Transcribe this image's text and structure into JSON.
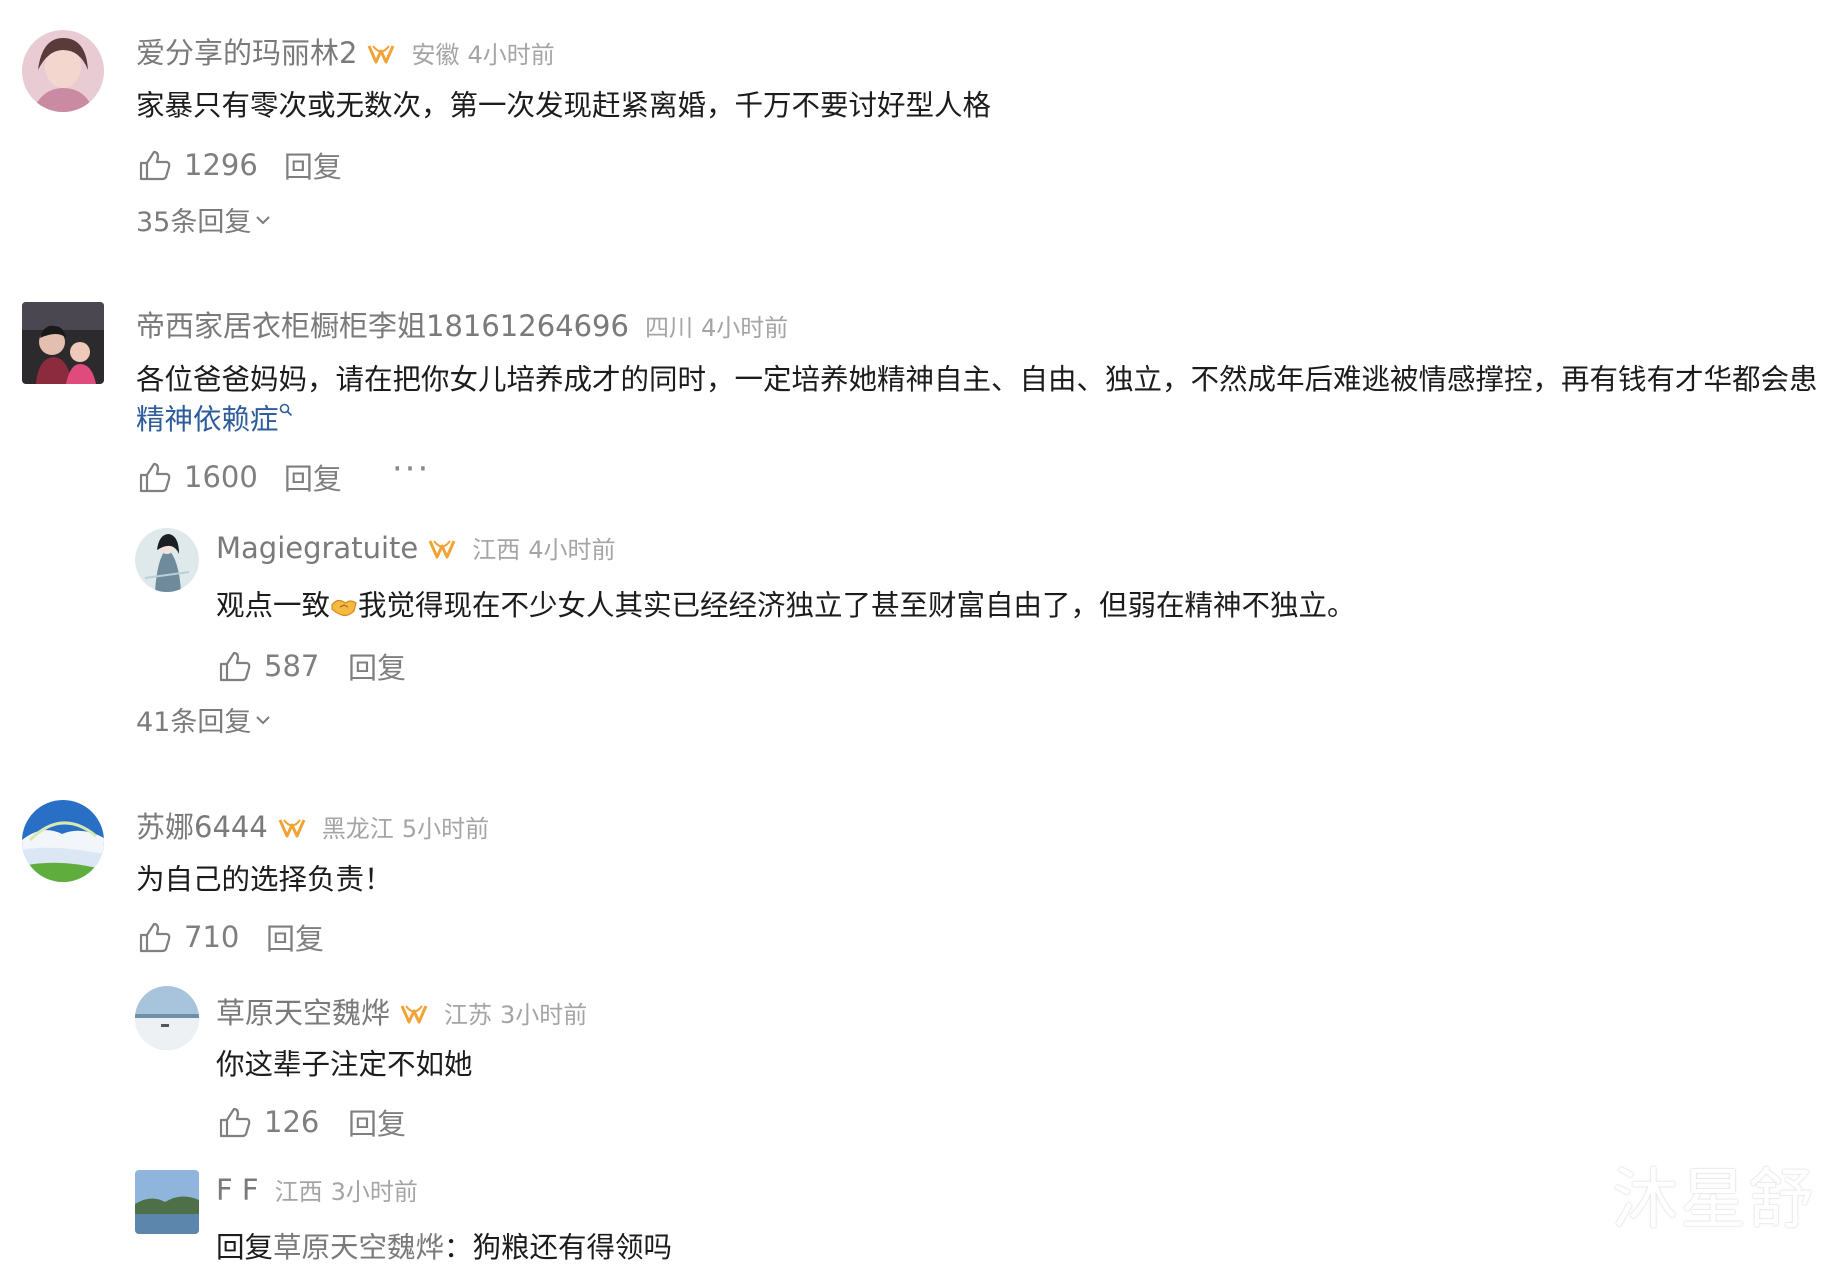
{
  "comments": [
    {
      "username": "爱分享的玛丽林2",
      "location": "安徽",
      "time": "4小时前",
      "text": "家暴只有零次或无数次，第一次发现赶紧离婚，千万不要讨好型人格",
      "likes": "1296",
      "reply_label": "回复",
      "more_replies": "35条回复"
    },
    {
      "username": "帝西家居衣柜橱柜李姐18161264696",
      "location": "四川",
      "time": "4小时前",
      "text": "各位爸爸妈妈，请在把你女儿培养成才的同时，一定培养她精神自主、自由、独立，不然成年后难逃被情感撑控，再有钱有才华都会患",
      "link_text": "精神依赖症",
      "likes": "1600",
      "reply_label": "回复",
      "more_label": "···",
      "sub_reply": {
        "username": "Magiegratuite",
        "location": "江西",
        "time": "4小时前",
        "text_before": "观点一致",
        "text_after": "我觉得现在不少女人其实已经经济独立了甚至财富自由了，但弱在精神不独立。",
        "likes": "587",
        "reply_label": "回复"
      },
      "more_replies": "41条回复"
    },
    {
      "username": "苏娜6444",
      "location": "黑龙江",
      "time": "5小时前",
      "text": "为自己的选择负责！",
      "likes": "710",
      "reply_label": "回复",
      "sub_reply": {
        "username": "草原天空魏烨",
        "location": "江苏",
        "time": "3小时前",
        "text": "你这辈子注定不如她",
        "likes": "126",
        "reply_label": "回复"
      },
      "sub_reply_2": {
        "username": "F F",
        "location": "江西",
        "time": "3小时前",
        "text_prefix": "回复",
        "mention": "草原天空魏烨",
        "text": "：狗粮还有得领吗"
      }
    }
  ],
  "watermark": "沐星舒",
  "colors": {
    "username": "#7a7a7a",
    "meta": "#a5a5a5",
    "link": "#2f5c9a",
    "badge": "#f0a437"
  }
}
